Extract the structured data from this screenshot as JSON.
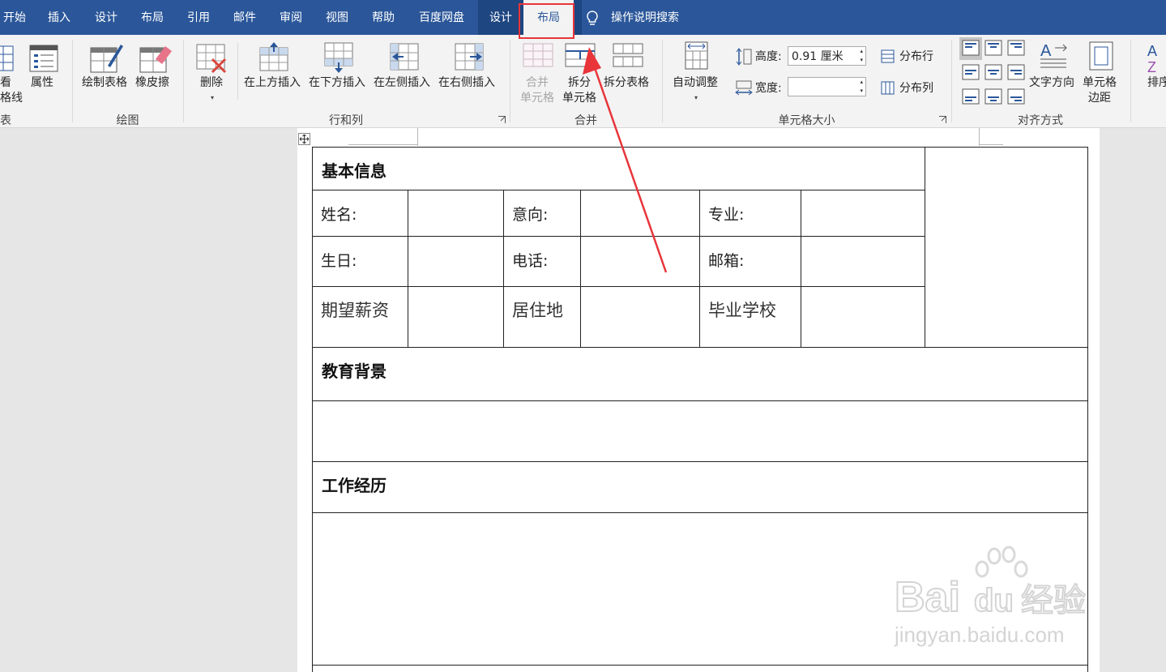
{
  "tabs": {
    "home": "开始",
    "insert": "插入",
    "design": "设计",
    "layout": "布局",
    "references": "引用",
    "mailings": "邮件",
    "review": "审阅",
    "view": "视图",
    "help": "帮助",
    "baidu": "百度网盘",
    "table_design": "设计",
    "table_layout": "布局",
    "search": "操作说明搜索"
  },
  "ribbon": {
    "table_group": {
      "view_gridlines_1": "看",
      "view_gridlines_2": "格线",
      "properties": "属性",
      "label": "表"
    },
    "draw_group": {
      "draw_table": "绘制表格",
      "eraser": "橡皮擦",
      "label": "绘图"
    },
    "rows_cols_group": {
      "delete": "删除",
      "insert_above": "在上方插入",
      "insert_below": "在下方插入",
      "insert_left": "在左侧插入",
      "insert_right": "在右侧插入",
      "label": "行和列"
    },
    "merge_group": {
      "merge_1": "合并",
      "merge_2": "单元格",
      "split_1": "拆分",
      "split_2": "单元格",
      "split_table": "拆分表格",
      "label": "合并"
    },
    "cell_size_group": {
      "autofit": "自动调整",
      "height_label": "高度:",
      "height_value": "0.91 厘米",
      "width_label": "宽度:",
      "width_value": "",
      "distribute_rows": "分布行",
      "distribute_cols": "分布列",
      "label": "单元格大小"
    },
    "align_group": {
      "text_direction": "文字方向",
      "cell_margins_1": "单元格",
      "cell_margins_2": "边距",
      "label": "对齐方式"
    },
    "data_group": {
      "sort": "排序"
    }
  },
  "document": {
    "basic_info": "基本信息",
    "name": "姓名:",
    "intent": "意向:",
    "major": "专业:",
    "birthday": "生日:",
    "phone": "电话:",
    "email": "邮箱:",
    "salary": "期望薪资",
    "residence": "居住地",
    "school": "毕业学校",
    "education": "教育背景",
    "work": "工作经历"
  },
  "watermark": {
    "brand": "Bai经验",
    "url": "jingyan.baidu.com"
  },
  "colors": {
    "ribbon_blue": "#2b579a",
    "annotation_red": "#e8353a"
  }
}
